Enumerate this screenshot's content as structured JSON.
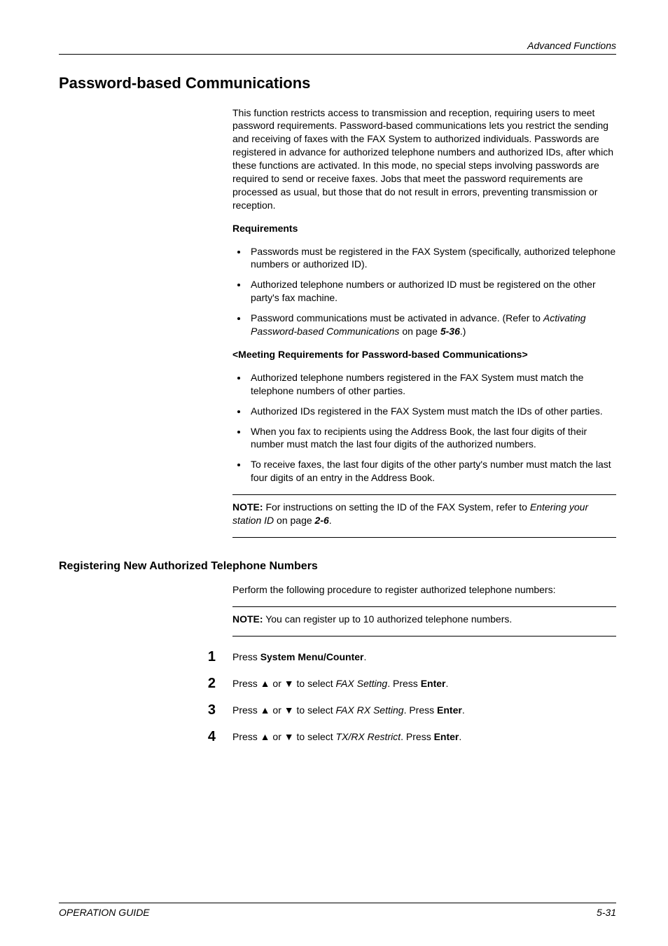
{
  "running_head": "Advanced Functions",
  "h1": "Password-based Communications",
  "intro": "This function restricts access to transmission and reception, requiring users to meet password requirements. Password-based communications lets you restrict the sending and receiving of faxes with the FAX System to authorized individuals. Passwords are registered in advance for authorized telephone numbers and authorized IDs, after which these functions are activated. In this mode, no special steps involving passwords are required to send or receive faxes. Jobs that meet the password requirements are processed as usual, but those that do not result in errors, preventing transmission or reception.",
  "req_heading": "Requirements",
  "req_items": [
    "Passwords must be registered in the FAX System (specifically, authorized telephone numbers or authorized ID).",
    "Authorized telephone numbers or authorized ID must be registered on the other party's fax machine."
  ],
  "req_item3_pre": "Password communications must be activated in advance. (Refer to ",
  "req_item3_ital": "Activating Password-based Communications",
  "req_item3_mid": " on page ",
  "req_item3_page": "5-36",
  "req_item3_post": ".)",
  "meeting_heading": "<Meeting Requirements for Password-based Communications>",
  "meeting_items": [
    "Authorized telephone numbers registered in the FAX System must match the telephone numbers of other parties.",
    "Authorized IDs registered in the FAX System must match the IDs of other parties.",
    "When you fax to recipients using the Address Book, the last four digits of their number must match the last four digits of the authorized numbers.",
    "To receive faxes, the last four digits of the other party's number must match the last four digits of an entry in the Address Book."
  ],
  "note1_label": "NOTE:",
  "note1_pre": " For instructions on setting the ID of the FAX System, refer to ",
  "note1_ital": "Entering your station ID",
  "note1_mid": " on page ",
  "note1_page": "2-6",
  "note1_post": ".",
  "h2": "Registering New Authorized Telephone Numbers",
  "h2_intro": "Perform the following procedure to register authorized telephone numbers:",
  "note2_label": "NOTE:",
  "note2_text": " You can register up to 10 authorized telephone numbers.",
  "steps": {
    "s1": {
      "n": "1",
      "pre": "Press ",
      "b1": "System Menu/Counter",
      "post": "."
    },
    "s2": {
      "n": "2",
      "pre": "Press ▲ or ▼ to select ",
      "i1": "FAX Setting",
      "mid": ". Press ",
      "b1": "Enter",
      "post": "."
    },
    "s3": {
      "n": "3",
      "pre": "Press ▲ or ▼ to select ",
      "i1": "FAX RX Setting",
      "mid": ". Press ",
      "b1": "Enter",
      "post": "."
    },
    "s4": {
      "n": "4",
      "pre": "Press ▲ or ▼ to select ",
      "i1": "TX/RX Restrict",
      "mid": ". Press ",
      "b1": "Enter",
      "post": "."
    }
  },
  "footer_left": "OPERATION GUIDE",
  "footer_right": "5-31"
}
